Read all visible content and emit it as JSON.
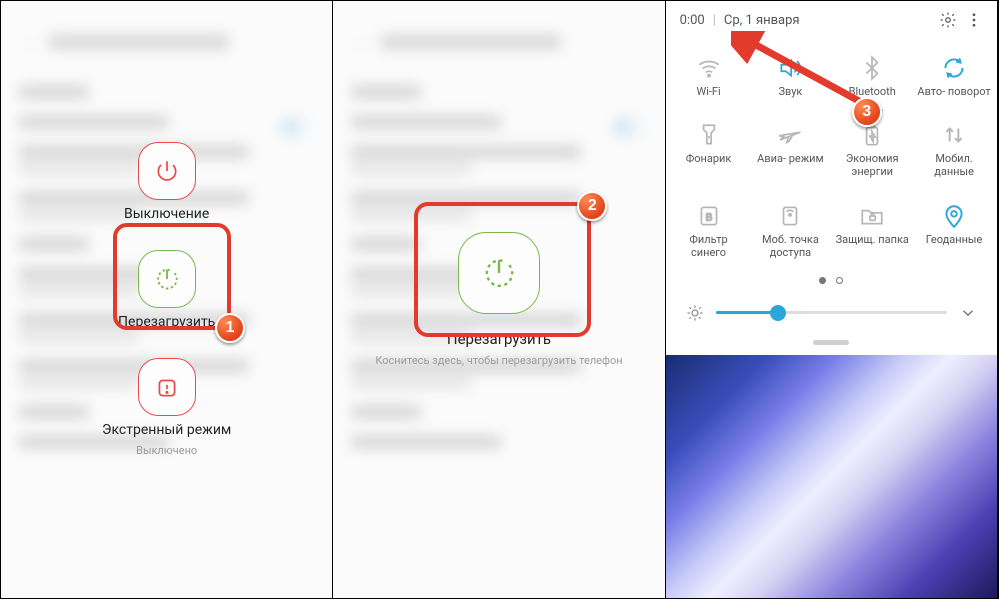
{
  "panel1": {
    "power_off": "Выключение",
    "restart": "Перезагрузить",
    "emergency": "Экстренный режим",
    "emergency_sub": "Выключено"
  },
  "panel2": {
    "restart": "Перезагрузить",
    "hint": "Коснитесь здесь, чтобы перезагрузить телефон"
  },
  "panel3": {
    "time": "0:00",
    "date": "Ср, 1 января",
    "tiles": [
      {
        "label": "Wi-Fi",
        "active": false
      },
      {
        "label": "Звук",
        "active": true
      },
      {
        "label": "Bluetooth",
        "active": false
      },
      {
        "label": "Авто-\nповорот",
        "active": true
      },
      {
        "label": "Фонарик",
        "active": false
      },
      {
        "label": "Авиа-\nрежим",
        "active": false
      },
      {
        "label": "Экономия\nэнергии",
        "active": false
      },
      {
        "label": "Мобил.\nданные",
        "active": false
      },
      {
        "label": "Фильтр\nсинего",
        "active": false
      },
      {
        "label": "Моб. точка\nдоступа",
        "active": false
      },
      {
        "label": "Защищ.\nпапка",
        "active": false
      },
      {
        "label": "Геоданные",
        "active": true
      }
    ],
    "brightness_pct": 27
  },
  "steps": {
    "s1": "1",
    "s2": "2",
    "s3": "3"
  }
}
